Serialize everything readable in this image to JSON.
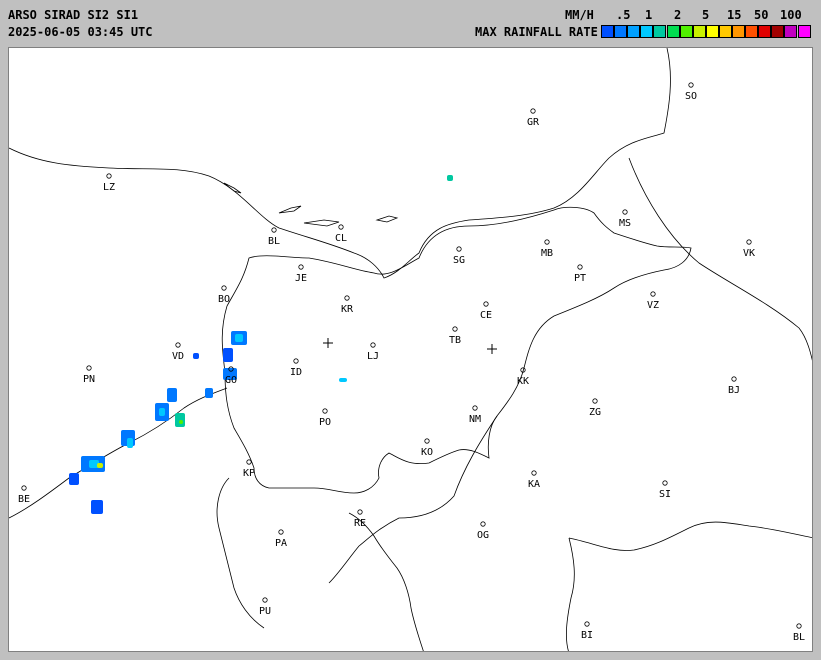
{
  "header": {
    "title": "ARSO SIRAD SI2 SI1",
    "timestamp": "2025-06-05 03:45 UTC",
    "unit": "MM/H",
    "legend_title": "MAX RAINFALL RATE",
    "scale_labels": [
      ".5",
      "1",
      "2",
      "5",
      "15",
      "50",
      "100"
    ],
    "scale_colors": [
      "#0050ff",
      "#0078ff",
      "#00a0ff",
      "#00c8ff",
      "#00c8a0",
      "#00dc50",
      "#50f000",
      "#c8f000",
      "#ffff00",
      "#ffc800",
      "#ff9600",
      "#ff5000",
      "#e00000",
      "#a00000",
      "#c000c0",
      "#ff00ff"
    ]
  },
  "places": [
    {
      "name": "LZ"
    },
    {
      "name": "GR"
    },
    {
      "name": "SO"
    },
    {
      "name": "BL"
    },
    {
      "name": "CL"
    },
    {
      "name": "MS"
    },
    {
      "name": "MB"
    },
    {
      "name": "VK"
    },
    {
      "name": "SG"
    },
    {
      "name": "JE"
    },
    {
      "name": "PT"
    },
    {
      "name": "BO"
    },
    {
      "name": "KR"
    },
    {
      "name": "CE"
    },
    {
      "name": "VZ"
    },
    {
      "name": "VD"
    },
    {
      "name": "LJ"
    },
    {
      "name": "TB"
    },
    {
      "name": "PN"
    },
    {
      "name": "GO"
    },
    {
      "name": "ID"
    },
    {
      "name": "KK"
    },
    {
      "name": "BJ"
    },
    {
      "name": "NM"
    },
    {
      "name": "ZG"
    },
    {
      "name": "PO"
    },
    {
      "name": "KO"
    },
    {
      "name": "KP"
    },
    {
      "name": "KA"
    },
    {
      "name": "SI"
    },
    {
      "name": "BE"
    },
    {
      "name": "RE"
    },
    {
      "name": "OG"
    },
    {
      "name": "PA"
    },
    {
      "name": "PU"
    },
    {
      "name": "BI"
    },
    {
      "name": "BL"
    }
  ]
}
